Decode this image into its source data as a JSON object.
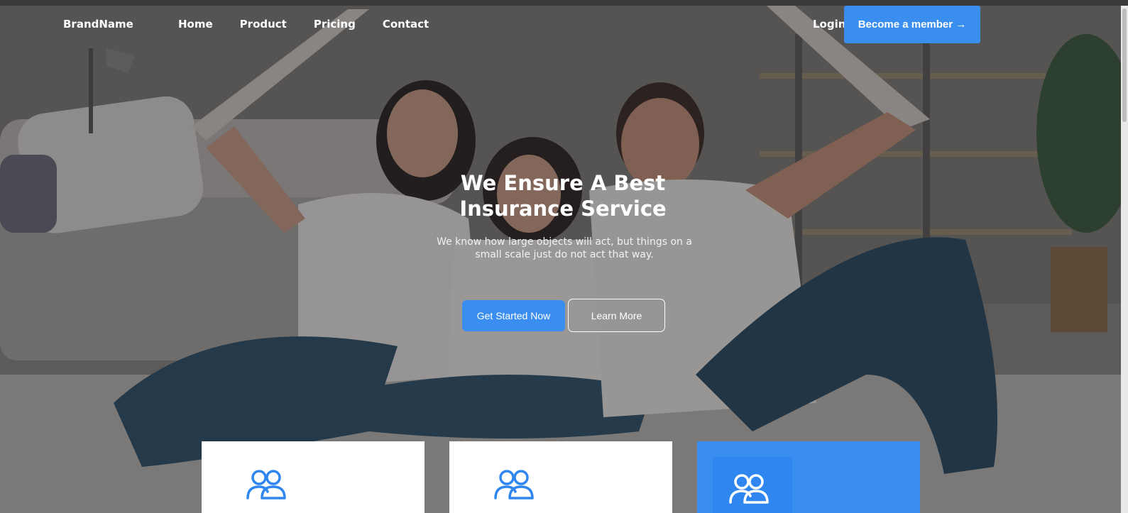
{
  "nav": {
    "brand": "BrandName",
    "links": [
      "Home",
      "Product",
      "Pricing",
      "Contact"
    ],
    "login": "Login",
    "member_button": "Become a member →"
  },
  "hero": {
    "title_line1": "We Ensure A Best",
    "title_line2": "Insurance Service",
    "subtitle_line1": "We know how large objects will act, but things on a",
    "subtitle_line2": "small scale just do not act that way.",
    "primary_button": "Get Started Now",
    "secondary_button": "Learn More"
  },
  "cards": [
    {
      "icon": "users-icon"
    },
    {
      "icon": "users-icon"
    },
    {
      "icon": "users-icon",
      "highlighted": true
    }
  ],
  "colors": {
    "accent": "#3a8ef0",
    "card_bg": "#ffffff",
    "text_on_dark": "#ffffff"
  }
}
